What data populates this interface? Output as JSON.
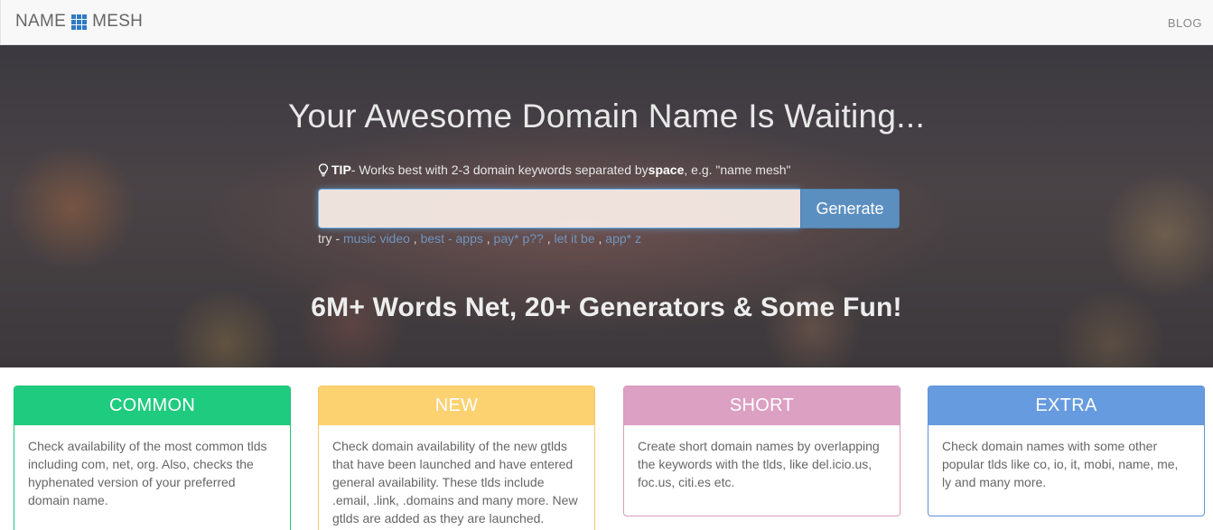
{
  "navbar": {
    "brand_left": "NAME",
    "brand_icon": "grid-icon",
    "brand_right": "MESH",
    "blog_label": "BLOG"
  },
  "hero": {
    "title": "Your Awesome Domain Name Is Waiting...",
    "tip": {
      "icon": "lightbulb-icon",
      "label": "TIP",
      "text_before": " - Works best with 2-3 domain keywords separated by ",
      "keyword": "space",
      "text_after": ", e.g. \"name mesh\""
    },
    "search": {
      "value": "",
      "placeholder": "",
      "button_label": "Generate"
    },
    "try": {
      "label": "try - ",
      "examples": [
        "music video",
        "best - apps",
        "pay* p??",
        "let it be",
        "app* z"
      ],
      "separator": " , "
    },
    "subtitle": "6M+ Words Net, 20+ Generators & Some Fun!"
  },
  "panels": [
    {
      "title": "COMMON",
      "body": "Check availability of the most common tlds including com, net, org. Also, checks the hyphenated version of your preferred domain name.",
      "color": "#1fcb7e"
    },
    {
      "title": "NEW",
      "body": "Check domain availability of the new gtlds that have been launched and have entered general availability. These tlds include .email, .link, .domains and many more. New gtlds are added as they are launched.",
      "color": "#fcd170"
    },
    {
      "title": "SHORT",
      "body": "Create short domain names by overlapping the keywords with the tlds, like del.icio.us, foc.us, citi.es etc.",
      "color": "#dca0c3"
    },
    {
      "title": "EXTRA",
      "body": "Check domain names with some other popular tlds like co, io, it, mobi, name, me, ly and many more.",
      "color": "#679bdf"
    }
  ],
  "colors": {
    "accent": "#5b8fc0",
    "link": "#6f95c0",
    "brand_icon": "#2f7bc4"
  }
}
